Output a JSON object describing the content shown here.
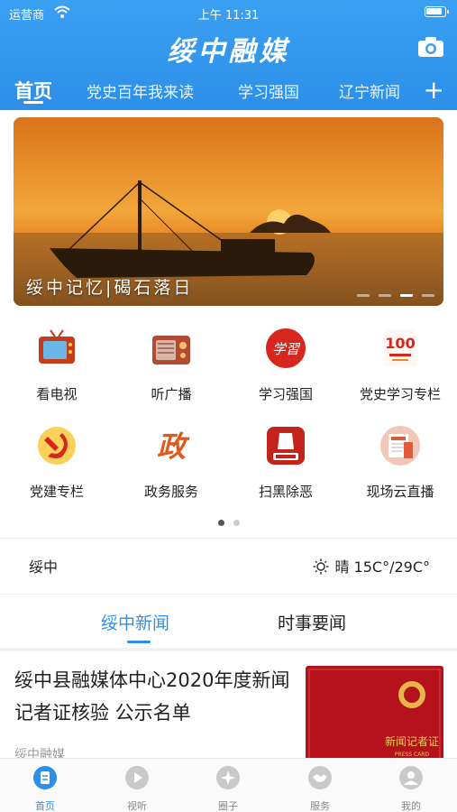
{
  "status_bar": {
    "carrier": "运营商",
    "time": "上午 11:31"
  },
  "app": {
    "title": "绥中融媒"
  },
  "tabs": [
    {
      "label": "首页",
      "active": true
    },
    {
      "label": "党史百年我来读"
    },
    {
      "label": "学习强国"
    },
    {
      "label": "辽宁新闻"
    }
  ],
  "banner": {
    "caption": "绥中记忆|碣石落日",
    "slides": 4,
    "active_slide": 3
  },
  "features": [
    {
      "label": "看电视",
      "icon": "tv-icon"
    },
    {
      "label": "听广播",
      "icon": "radio-icon"
    },
    {
      "label": "学习强国",
      "icon": "xuexi-icon"
    },
    {
      "label": "党史学习专栏",
      "icon": "party-history-icon"
    },
    {
      "label": "党建专栏",
      "icon": "party-emblem-icon"
    },
    {
      "label": "政务服务",
      "icon": "government-icon"
    },
    {
      "label": "扫黑除恶",
      "icon": "anti-crime-icon"
    },
    {
      "label": "现场云直播",
      "icon": "live-news-icon"
    }
  ],
  "features_pages": 2,
  "features_active_page": 1,
  "weather": {
    "city": "绥中",
    "condition": "晴",
    "temperature": "15C°/29C°"
  },
  "news_tabs": [
    {
      "label": "绥中新闻",
      "active": true
    },
    {
      "label": "时事要闻"
    }
  ],
  "news": [
    {
      "title": "绥中县融媒体中心2020年度新闻记者证核验 公示名单",
      "source": "绥中融媒",
      "thumb_text": "新闻记者证",
      "thumb_sub": "PRESS CARD"
    }
  ],
  "bottom_nav": [
    {
      "label": "首页",
      "active": true
    },
    {
      "label": "视听"
    },
    {
      "label": "圈子"
    },
    {
      "label": "服务"
    },
    {
      "label": "我的"
    }
  ],
  "colors": {
    "accent": "#2d8fe8",
    "header": "#3aa0f2",
    "party_red": "#d7261e"
  }
}
